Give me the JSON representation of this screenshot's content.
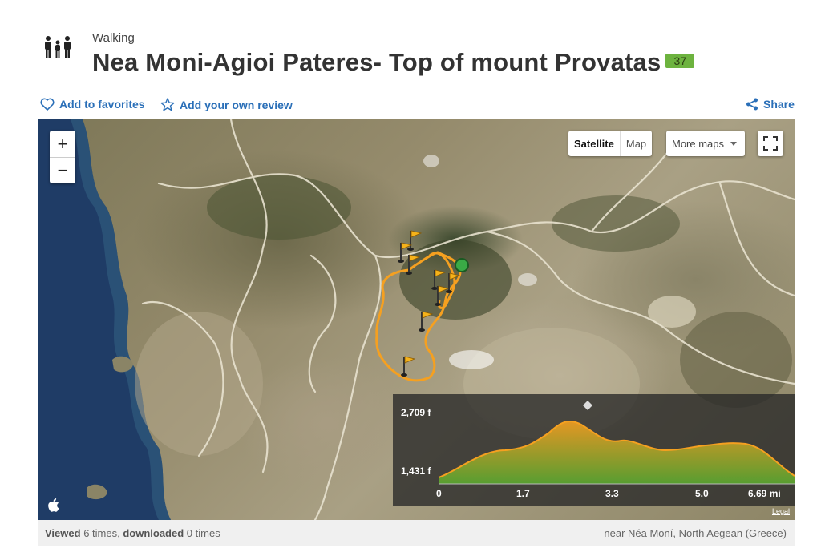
{
  "header": {
    "activity": "Walking",
    "title": "Nea Moni-Agioi Pateres- Top of mount Provatas",
    "badge": "37"
  },
  "actions": {
    "favorites": "Add to favorites",
    "review": "Add your own review",
    "share": "Share"
  },
  "map": {
    "zoom_in": "+",
    "zoom_out": "−",
    "maptype_active": "Satellite",
    "maptype_inactive": "Map",
    "more_maps": "More maps",
    "legal": "Legal"
  },
  "elevation": {
    "max_label": "2,709 f",
    "min_label": "1,431 f",
    "x_ticks": [
      "0",
      "1.7",
      "3.3",
      "5.0",
      "6.69 mi"
    ]
  },
  "footer": {
    "viewed_label": "Viewed",
    "viewed_count": "6 times,",
    "downloaded_label": "downloaded",
    "downloaded_count": "0 times",
    "location": "near Néa Moní, North Aegean (Greece)"
  },
  "colors": {
    "link": "#2a6fb8",
    "badge": "#6db33f",
    "track": "#f5a020",
    "elevation_top": "#f5a020",
    "elevation_bottom": "#5aa830"
  }
}
